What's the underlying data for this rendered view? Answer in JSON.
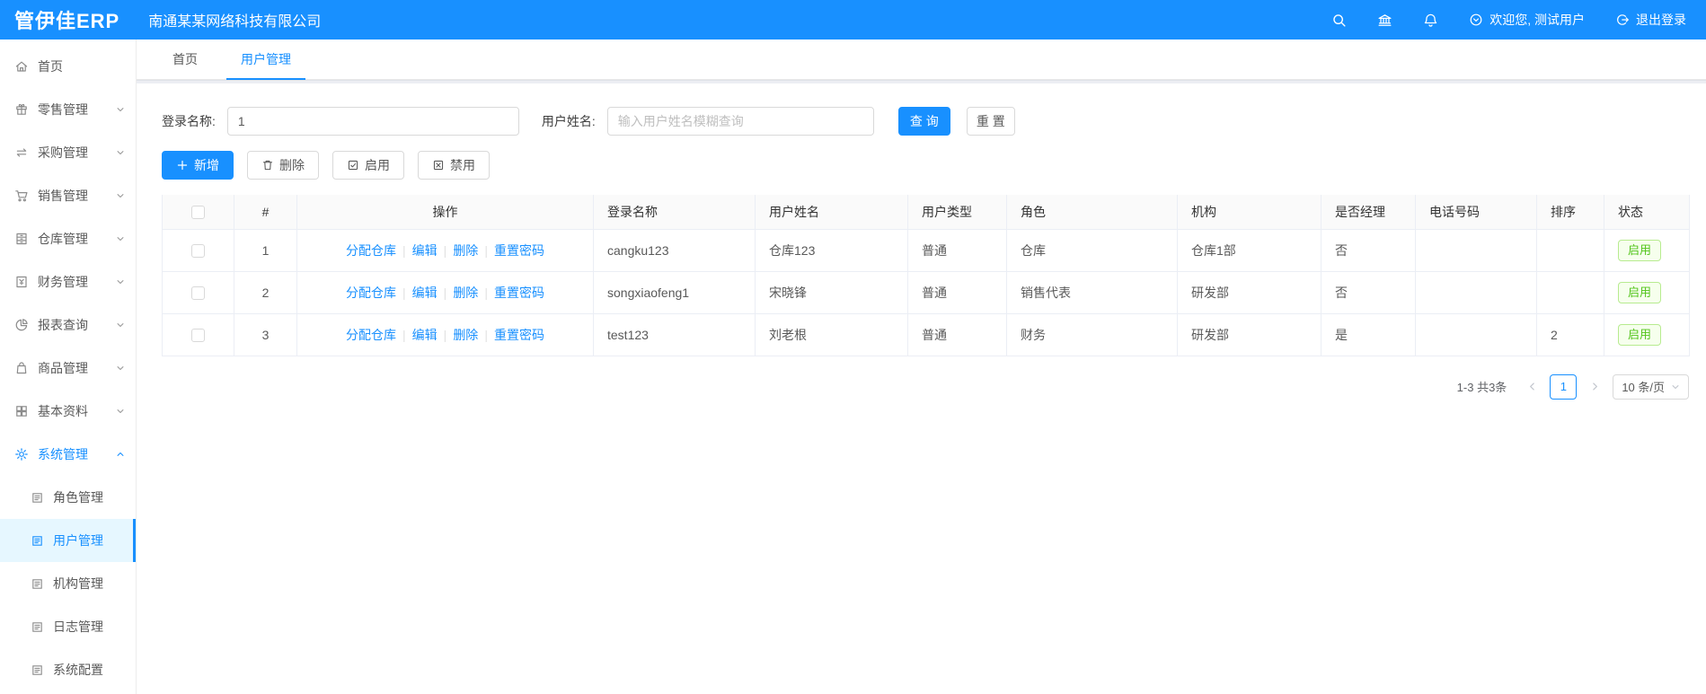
{
  "topbar": {
    "logo": "管伊佳ERP",
    "company": "南通某某网络科技有限公司",
    "welcome": "欢迎您, 测试用户",
    "logout": "退出登录"
  },
  "sidebar": {
    "items": [
      {
        "label": "首页",
        "icon": "home-icon"
      },
      {
        "label": "零售管理",
        "icon": "retail-icon"
      },
      {
        "label": "采购管理",
        "icon": "purchase-icon"
      },
      {
        "label": "销售管理",
        "icon": "sales-icon"
      },
      {
        "label": "仓库管理",
        "icon": "warehouse-icon"
      },
      {
        "label": "财务管理",
        "icon": "finance-icon"
      },
      {
        "label": "报表查询",
        "icon": "report-icon"
      },
      {
        "label": "商品管理",
        "icon": "goods-icon"
      },
      {
        "label": "基本资料",
        "icon": "basic-data-icon"
      },
      {
        "label": "系统管理",
        "icon": "gear-icon",
        "expanded": true,
        "active": true
      }
    ],
    "subitems": [
      "角色管理",
      "用户管理",
      "机构管理",
      "日志管理",
      "系统配置"
    ],
    "active_subitem": "用户管理"
  },
  "tabs": [
    {
      "label": "首页"
    },
    {
      "label": "用户管理",
      "active": true
    }
  ],
  "filters": {
    "login_name_label": "登录名称:",
    "login_name_value": "1",
    "user_name_label": "用户姓名:",
    "user_name_placeholder": "输入用户姓名模糊查询",
    "search_button": "查 询",
    "reset_button": "重 置"
  },
  "actions": {
    "add": "新增",
    "delete": "删除",
    "enable": "启用",
    "disable": "禁用"
  },
  "table": {
    "headers": [
      "#",
      "操作",
      "登录名称",
      "用户姓名",
      "用户类型",
      "角色",
      "机构",
      "是否经理",
      "电话号码",
      "排序",
      "状态"
    ],
    "row_actions": [
      "分配仓库",
      "编辑",
      "删除",
      "重置密码"
    ],
    "rows": [
      {
        "idx": "1",
        "login": "cangku123",
        "name": "仓库123",
        "type": "普通",
        "role": "仓库",
        "org": "仓库1部",
        "manager": "否",
        "phone": "",
        "sort": "",
        "status": "启用"
      },
      {
        "idx": "2",
        "login": "songxiaofeng1",
        "name": "宋晓锋",
        "type": "普通",
        "role": "销售代表",
        "org": "研发部",
        "manager": "否",
        "phone": "",
        "sort": "",
        "status": "启用"
      },
      {
        "idx": "3",
        "login": "test123",
        "name": "刘老根",
        "type": "普通",
        "role": "财务",
        "org": "研发部",
        "manager": "是",
        "phone": "",
        "sort": "2",
        "status": "启用"
      }
    ]
  },
  "pagination": {
    "total": "1-3 共3条",
    "page": "1",
    "size": "10 条/页"
  },
  "colors": {
    "primary": "#1890ff",
    "success": "#52c41a"
  }
}
